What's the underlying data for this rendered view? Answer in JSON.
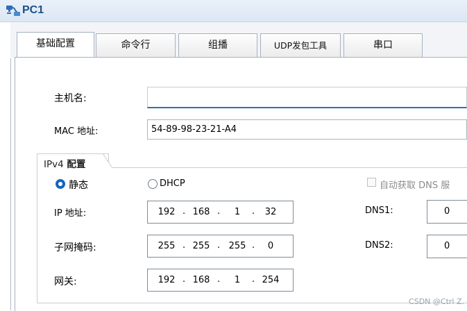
{
  "window": {
    "title": "PC1",
    "icon": "network-pc-icon"
  },
  "tabs": [
    {
      "label": "基础配置",
      "active": true
    },
    {
      "label": "命令行",
      "active": false
    },
    {
      "label": "组播",
      "active": false
    },
    {
      "label": "UDP发包工具",
      "active": false
    },
    {
      "label": "串口",
      "active": false
    }
  ],
  "basic": {
    "hostname_label": "主机名:",
    "hostname_value": "",
    "mac_label": "MAC 地址:",
    "mac_value": "54-89-98-23-21-A4"
  },
  "ipv4": {
    "group_prefix": "IPv4",
    "group_title": "配置",
    "mode": "static",
    "static_label": "静态",
    "dhcp_label": "DHCP",
    "auto_dns_label": "自动获取 DNS 服",
    "auto_dns_checked": false,
    "ip_label": "IP 地址:",
    "ip": [
      "192",
      "168",
      "1",
      "32"
    ],
    "mask_label": "子网掩码:",
    "mask": [
      "255",
      "255",
      "255",
      "0"
    ],
    "gateway_label": "网关:",
    "gateway": [
      "192",
      "168",
      "1",
      "254"
    ],
    "dns1_label": "DNS1:",
    "dns1_value": "0",
    "dns2_label": "DNS2:",
    "dns2_value": "0"
  },
  "watermark": "CSDN @Ctrl Z.",
  "colors": {
    "accent": "#1565c0",
    "title": "#1e4f86"
  }
}
